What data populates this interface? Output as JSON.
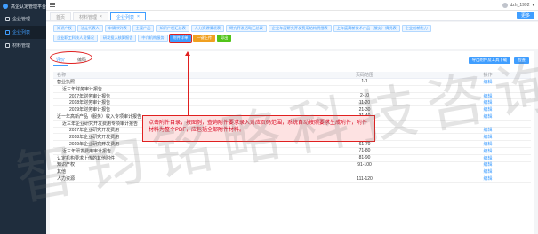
{
  "app": {
    "brand": "高企认定管理平台"
  },
  "sidebar": {
    "items": [
      {
        "label": "企业管理"
      },
      {
        "label": "企业列表"
      },
      {
        "label": "材料管理"
      }
    ]
  },
  "header": {
    "user": "dzh_1992"
  },
  "page_tabs": [
    {
      "label": "首页"
    },
    {
      "label": "材料管理"
    },
    {
      "label": "企业列表"
    }
  ],
  "more_label": "更多",
  "toolbar": {
    "row1": [
      "知识产权",
      "法定代表人",
      "申请书列表",
      "主要产品",
      "知识产权汇总表",
      "人力资源情况表",
      "研究开发活动汇总表",
      "企业年度研究开发费用结构明细表",
      "上年度高新技术产品（服务）情况表",
      "企业创新能力"
    ],
    "row2": [
      "企业职工科技人员情况",
      "研发投入核算报告",
      "中介机构服务",
      "附件详单",
      "一键上传",
      "导出"
    ]
  },
  "sub_tabs": [
    {
      "label": "评价"
    },
    {
      "label": "编码"
    }
  ],
  "panel_buttons": [
    "导出附件及工具下载",
    "检查"
  ],
  "table": {
    "headers": [
      "名称",
      "页码范围",
      "操作"
    ],
    "rows": [
      {
        "name": "营业执照",
        "pages": "1-1",
        "action": "编辑",
        "indent": 0
      },
      {
        "name": "近三年财务审计报告",
        "pages": "",
        "action": "",
        "indent": 1
      },
      {
        "name": "2017年财务审计报告",
        "pages": "2-10",
        "action": "编辑",
        "indent": 2
      },
      {
        "name": "2018年财务审计报告",
        "pages": "11-20",
        "action": "编辑",
        "indent": 2
      },
      {
        "name": "2019年财务审计报告",
        "pages": "21-30",
        "action": "编辑",
        "indent": 2
      },
      {
        "name": "近一年高新产品（服务）收入专项审计报告",
        "pages": "31-40",
        "action": "编辑",
        "indent": 0
      },
      {
        "name": "近三年企业研究开发费用专项审计报告",
        "pages": "",
        "action": "",
        "indent": 1
      },
      {
        "name": "2017年企业研究开发费用",
        "pages": "41-50",
        "action": "编辑",
        "indent": 2
      },
      {
        "name": "2018年企业研究开发费用",
        "pages": "51-60",
        "action": "编辑",
        "indent": 2
      },
      {
        "name": "2019年企业研究开发费用",
        "pages": "61-70",
        "action": "编辑",
        "indent": 2
      },
      {
        "name": "近三年研发费用审计报告",
        "pages": "71-80",
        "action": "编辑",
        "indent": 1
      },
      {
        "name": "认定机构要求上传的其他附件",
        "pages": "81-90",
        "action": "编辑",
        "indent": 0
      },
      {
        "name": "知识产权",
        "pages": "91-100",
        "action": "编辑",
        "indent": 0
      },
      {
        "name": "其他",
        "pages": "",
        "action": "编辑",
        "indent": 0
      },
      {
        "name": "人力资源",
        "pages": "111-120",
        "action": "编辑",
        "indent": 0
      }
    ]
  },
  "callout": {
    "text": "点击附件目录，按图例，查询附件要求录入对应页码范围，系统自动按照要求生成附件，附件材料为整个PDF，应包括全部附件材料。"
  },
  "watermark": {
    "text": "智钧铭略科技咨询"
  },
  "colors": {
    "primary": "#409eff",
    "sidebar": "#1f2d3d",
    "annotation": "#e02020"
  }
}
